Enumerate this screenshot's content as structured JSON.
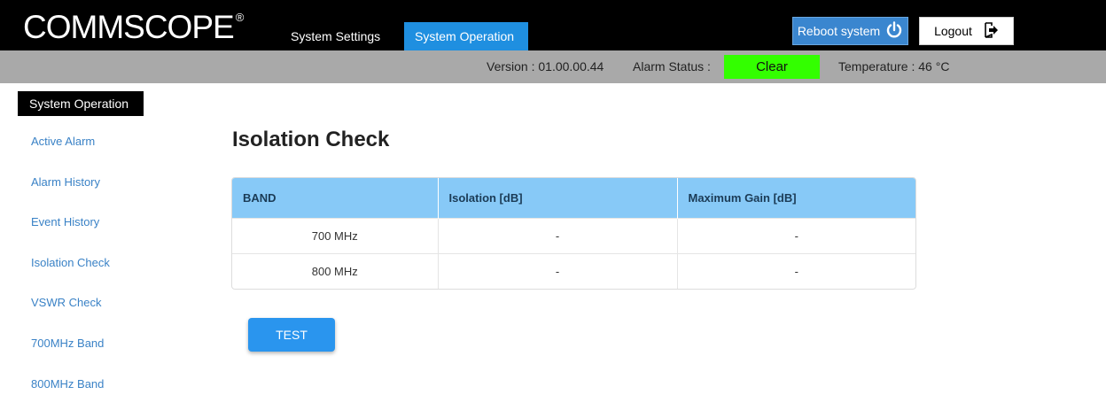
{
  "header": {
    "logo_text": "COMMSCOPE",
    "logo_reg": "®",
    "tabs": [
      {
        "label": "System Settings"
      },
      {
        "label": "System Operation"
      }
    ],
    "reboot_label": "Reboot system",
    "logout_label": "Logout"
  },
  "status": {
    "version": "Version : 01.00.00.44",
    "alarm_label": "Alarm Status :",
    "alarm_value": "Clear",
    "alarm_color": "#33ff00",
    "temperature": "Temperature : 46 °C"
  },
  "sidebar": {
    "header": "System Operation",
    "items": [
      {
        "label": "Active Alarm"
      },
      {
        "label": "Alarm History"
      },
      {
        "label": "Event History"
      },
      {
        "label": "Isolation Check"
      },
      {
        "label": "VSWR Check"
      },
      {
        "label": "700MHz Band"
      },
      {
        "label": "800MHz Band"
      }
    ]
  },
  "main": {
    "title": "Isolation Check",
    "table": {
      "headers": [
        "BAND",
        "Isolation [dB]",
        "Maximum Gain [dB]"
      ],
      "rows": [
        [
          "700 MHz",
          "-",
          "-"
        ],
        [
          "800 MHz",
          "-",
          "-"
        ]
      ]
    },
    "test_label": "TEST"
  },
  "colors": {
    "accent_tab": "#1f8fe0",
    "table_header": "#87c9f7",
    "link": "#3a82c6"
  }
}
